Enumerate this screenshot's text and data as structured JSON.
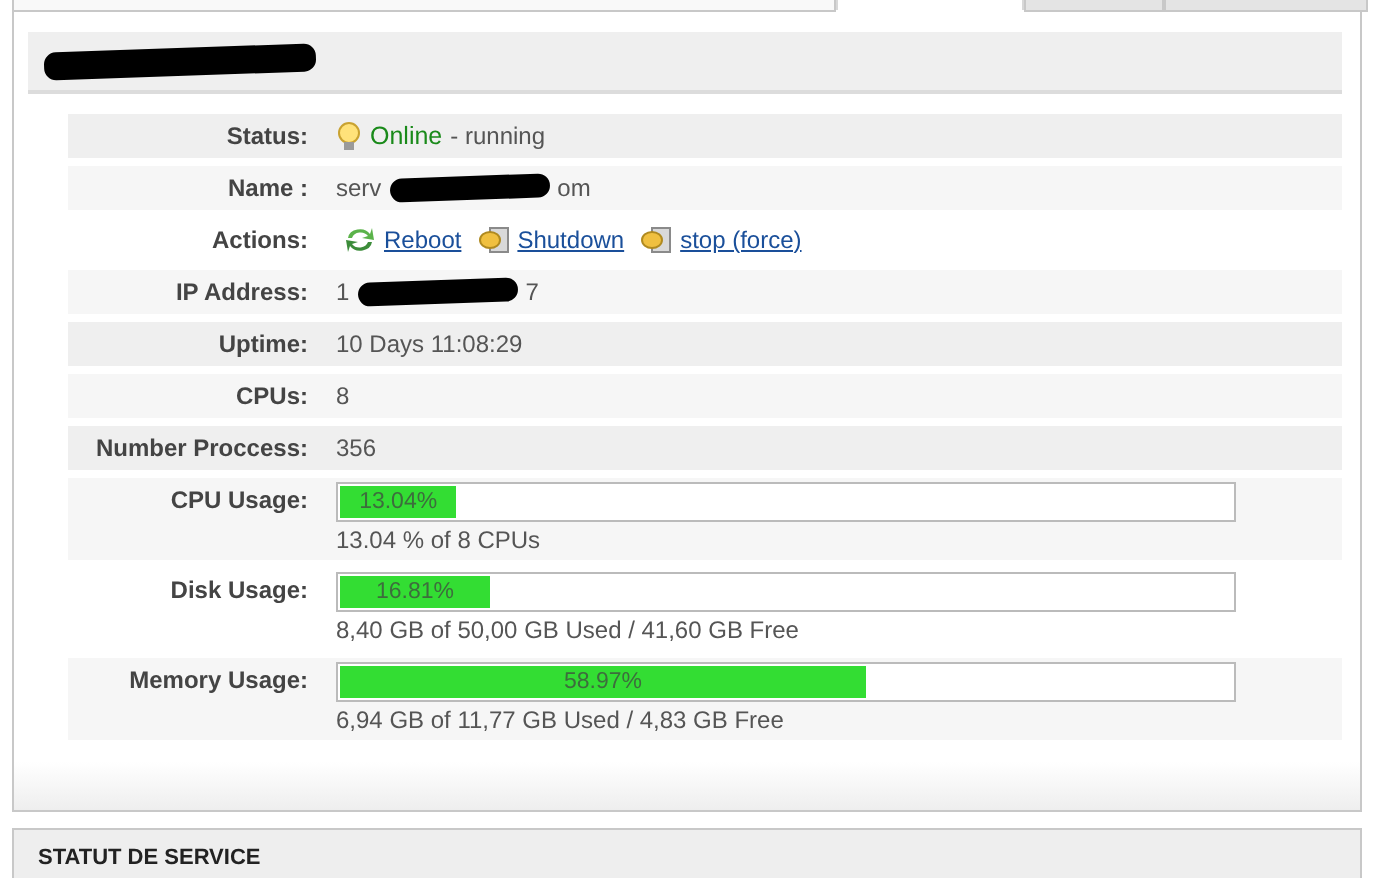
{
  "tabs": [
    {
      "selected": false
    },
    {
      "selected": true
    },
    {
      "selected": false
    },
    {
      "selected": false
    }
  ],
  "details": [
    {
      "kind": "status",
      "label": "Status:",
      "status": "Online",
      "note": "- running"
    },
    {
      "kind": "redacted",
      "label": "Name :",
      "before": "serv",
      "after": "om"
    },
    {
      "kind": "actions",
      "label": "Actions:",
      "actions": [
        "Reboot",
        "Shutdown",
        "stop (force)"
      ]
    },
    {
      "kind": "redacted",
      "label": "IP Address:",
      "before": "1",
      "after": "7"
    },
    {
      "kind": "text",
      "label": "Uptime:",
      "value": "10 Days 11:08:29"
    },
    {
      "kind": "text",
      "label": "CPUs:",
      "value": "8"
    },
    {
      "kind": "text",
      "label": "Number Proccess:",
      "value": "356"
    },
    {
      "kind": "usage",
      "label": "CPU Usage:",
      "level": 0.1304,
      "reading": "13.04%",
      "detail": "13.04 % of 8 CPUs"
    },
    {
      "kind": "usage",
      "label": "Disk Usage:",
      "level": 0.1681,
      "reading": "16.81%",
      "detail": "8,40 GB of 50,00 GB Used / 41,60 GB Free"
    },
    {
      "kind": "usage",
      "label": "Memory Usage:",
      "level": 0.5897,
      "reading": "58.97%",
      "detail": "6,94 GB of 11,77 GB Used / 4,83 GB Free"
    }
  ],
  "next_section": {
    "title": "STATUT DE SERVICE"
  }
}
